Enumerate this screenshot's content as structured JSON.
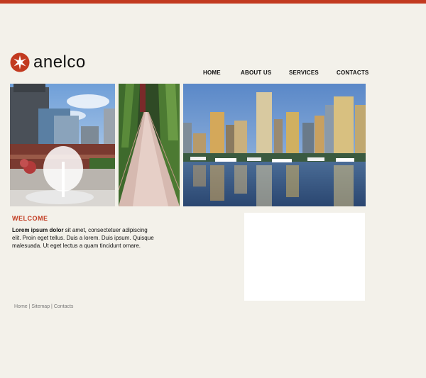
{
  "brand": {
    "name": "anelco",
    "accent": "#c23a20"
  },
  "nav": {
    "items": [
      "HOME",
      "ABOUT US",
      "SERVICES",
      "CONTACTS"
    ]
  },
  "welcome": {
    "title": "WELCOME",
    "lead": "Lorem ipsum dolor",
    "body": " sit amet, consectetuer adipiscing elit. Proin eget tellus. Duis a lorem. Duis ipsum. Quisque malesuada. Ut eget lectus a quam tincidunt ornare."
  },
  "footer": {
    "links": [
      "Home",
      "Sitemap",
      "Contacts"
    ],
    "separator": " | "
  }
}
